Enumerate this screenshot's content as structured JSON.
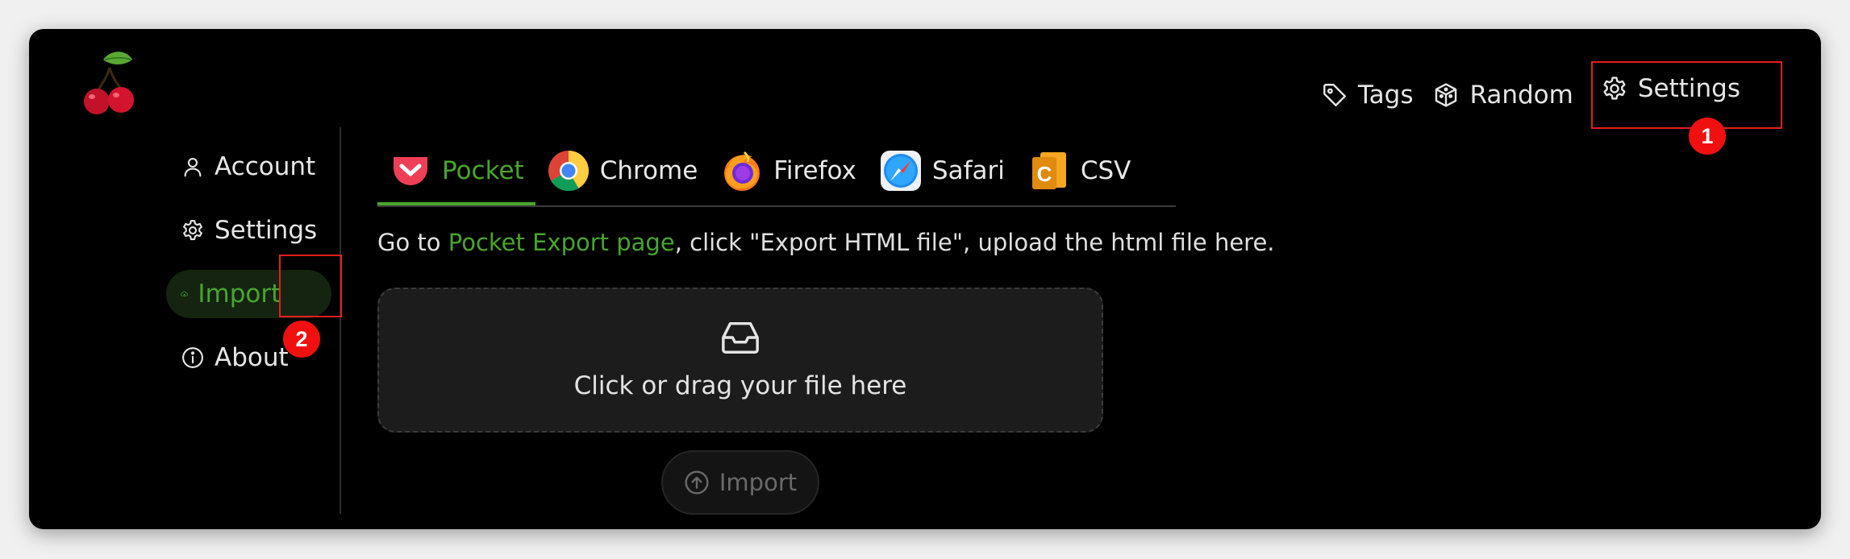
{
  "topnav": {
    "tags_label": "Tags",
    "random_label": "Random",
    "settings_label": "Settings"
  },
  "annotations": {
    "badge_1": "1",
    "badge_2": "2"
  },
  "sidebar": {
    "items": [
      {
        "label": "Account",
        "icon": "user-icon"
      },
      {
        "label": "Settings",
        "icon": "gear-icon"
      },
      {
        "label": "Import",
        "icon": "cloud-upload-icon",
        "active": true
      },
      {
        "label": "About",
        "icon": "info-icon"
      }
    ]
  },
  "tabs": [
    {
      "label": "Pocket",
      "icon": "pocket-icon",
      "active": true
    },
    {
      "label": "Chrome",
      "icon": "chrome-icon"
    },
    {
      "label": "Firefox",
      "icon": "firefox-icon"
    },
    {
      "label": "Safari",
      "icon": "safari-icon"
    },
    {
      "label": "CSV",
      "icon": "csv-icon"
    }
  ],
  "instruction": {
    "prefix": "Go to ",
    "link": "Pocket Export page",
    "suffix": ", click \"Export HTML file\", upload the html file here."
  },
  "dropzone": {
    "text": "Click or drag your file here"
  },
  "import_button": {
    "label": "Import"
  },
  "colors": {
    "accent": "#49a52c",
    "background": "#000000",
    "highlight": "#e41e1e",
    "badge": "#f01010"
  }
}
